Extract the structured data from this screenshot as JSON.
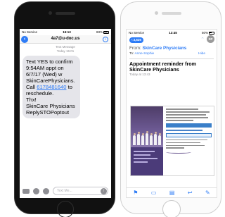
{
  "messages_screen": {
    "status_bar": {
      "carrier": "No Service",
      "time": "15:13",
      "battery": "83%"
    },
    "contact": "4a7@u-doc.us",
    "meta_line1": "Text Message",
    "meta_line2": "Today 15:01",
    "message_lines": [
      "Text YES to confirm",
      "9:54AM appt on",
      "6/7/17 (Wed) w",
      "SkinCarePhysicians.",
      "Call",
      "to",
      "reschedule.",
      "Thx!",
      "SkinCare Physicians",
      "ReplySTOPoptout"
    ],
    "phone_link": "6178481640",
    "input_placeholder": "Text Me..."
  },
  "mail_screen": {
    "status_bar": {
      "carrier": "No Service",
      "time": "13:45",
      "battery": "50%"
    },
    "inbox_count": "3,626",
    "from_label": "From:",
    "sender": "SkinCare Physicians",
    "to_label": "To:",
    "recipient": "Anne-Sophie",
    "hide_label": "Hide",
    "avatar_initials": "SP",
    "subject_line1": "Appointment reminder from",
    "subject_line2": "SkinCare Physicians",
    "date": "Today at 13:43"
  },
  "colors": {
    "ios_blue": "#2e7cf6",
    "bubble_grey": "#e5e5ea",
    "brand_purple": "#4b3b79"
  }
}
